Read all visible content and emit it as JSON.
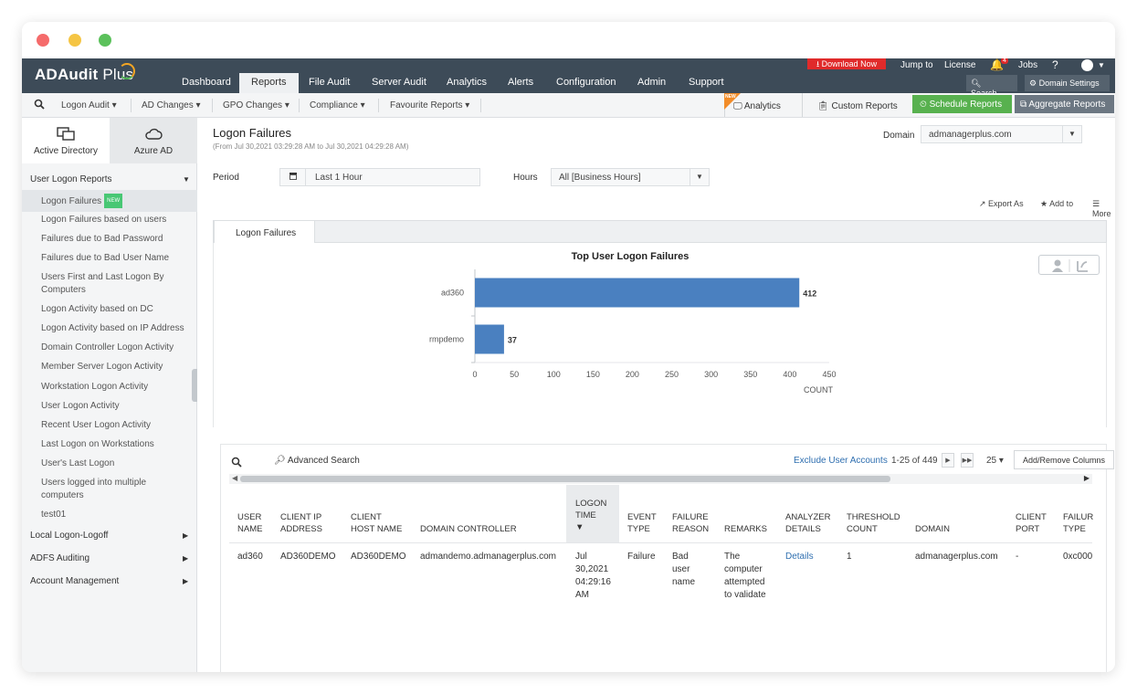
{
  "window_dots": [
    "#f56b6b",
    "#f5c544",
    "#5bc15b"
  ],
  "app": {
    "brand_name": "ADAudit",
    "brand_suffix": "Plus",
    "nav_tabs": [
      "Dashboard",
      "Reports",
      "File Audit",
      "Server Audit",
      "Analytics",
      "Alerts",
      "Configuration",
      "Admin",
      "Support"
    ],
    "active_tab": "Reports",
    "download_label": "Download Now",
    "top_links": [
      "Jump to",
      "License",
      "Jobs"
    ],
    "bell_badge": "4",
    "help_label": "?",
    "search_label": "Search...",
    "domain_settings_label": "Domain Settings"
  },
  "submenu": {
    "items": [
      "Logon Audit",
      "AD Changes",
      "GPO Changes",
      "Compliance",
      "Favourite Reports"
    ],
    "new_flag": "NEW",
    "analytics_label": "Analytics",
    "custom_reports_label": "Custom Reports",
    "schedule_label": "Schedule Reports",
    "aggregate_label": "Aggregate Reports"
  },
  "sidebar": {
    "tabs": [
      "Active Directory",
      "Azure AD"
    ],
    "section_user_logon": "User Logon Reports",
    "items": [
      "Logon Failures",
      "Logon Failures based on users",
      "Failures due to Bad Password",
      "Failures due to Bad User Name",
      "Users First and Last Logon By Computers",
      "Logon Activity based on DC",
      "Logon Activity based on IP Address",
      "Domain Controller Logon Activity",
      "Member Server Logon Activity",
      "Workstation Logon Activity",
      "User Logon Activity",
      "Recent User Logon Activity",
      "Last Logon on Workstations",
      "User's Last Logon",
      "Users logged into multiple computers",
      "test01"
    ],
    "new_tag": "NEW",
    "sections_collapsed": [
      "Local Logon-Logoff",
      "ADFS Auditing",
      "Account Management"
    ]
  },
  "report": {
    "title": "Logon Failures",
    "range": "(From Jul 30,2021 03:29:28 AM to Jul 30,2021 04:29:28 AM)",
    "domain_label": "Domain",
    "domain_value": "admanagerplus.com",
    "period_label": "Period",
    "period_value": "Last 1 Hour",
    "hours_label": "Hours",
    "hours_value": "All [Business Hours]",
    "actions": [
      "Export As",
      "Add to",
      "More"
    ],
    "tab_label": "Logon Failures"
  },
  "chart_data": {
    "type": "bar",
    "orientation": "horizontal",
    "title": "Top User Logon Failures",
    "categories": [
      "ad360",
      "rmpdemo"
    ],
    "values": [
      412,
      37
    ],
    "xlabel": "COUNT",
    "ylabel": "",
    "xlim": [
      0,
      450
    ],
    "ticks": [
      0,
      50,
      100,
      150,
      200,
      250,
      300,
      350,
      400,
      450
    ],
    "bar_color": "#4a80c0"
  },
  "table": {
    "advanced_search_label": "Advanced Search",
    "exclude_label": "Exclude User Accounts",
    "range_label": "1-25 of 449",
    "page_size": "25",
    "add_remove_label": "Add/Remove Columns",
    "columns": [
      [
        "USER",
        "NAME"
      ],
      [
        "CLIENT IP",
        "ADDRESS"
      ],
      [
        "CLIENT",
        "HOST NAME"
      ],
      [
        "DOMAIN CONTROLLER"
      ],
      [
        "LOGON",
        "TIME"
      ],
      [
        "EVENT",
        "TYPE"
      ],
      [
        "FAILURE",
        "REASON"
      ],
      [
        "REMARKS"
      ],
      [
        "ANALYZER",
        "DETAILS"
      ],
      [
        "THRESHOLD",
        "COUNT"
      ],
      [
        "DOMAIN"
      ],
      [
        "CLIENT",
        "PORT"
      ],
      [
        "FAILUR",
        "TYPE"
      ]
    ],
    "row": {
      "user": "ad360",
      "ip": "AD360DEMO",
      "host": "AD360DEMO",
      "dc": "admandemo.admanagerplus.com",
      "time": [
        "Jul",
        "30,2021",
        "04:29:16",
        "AM"
      ],
      "event": "Failure",
      "reason": [
        "Bad",
        "user",
        "name"
      ],
      "remarks": [
        "The",
        "computer",
        "attempted",
        "to validate"
      ],
      "details": "Details",
      "threshold": "1",
      "domain": "admanagerplus.com",
      "port": "-",
      "ftype": "0xc000"
    }
  }
}
